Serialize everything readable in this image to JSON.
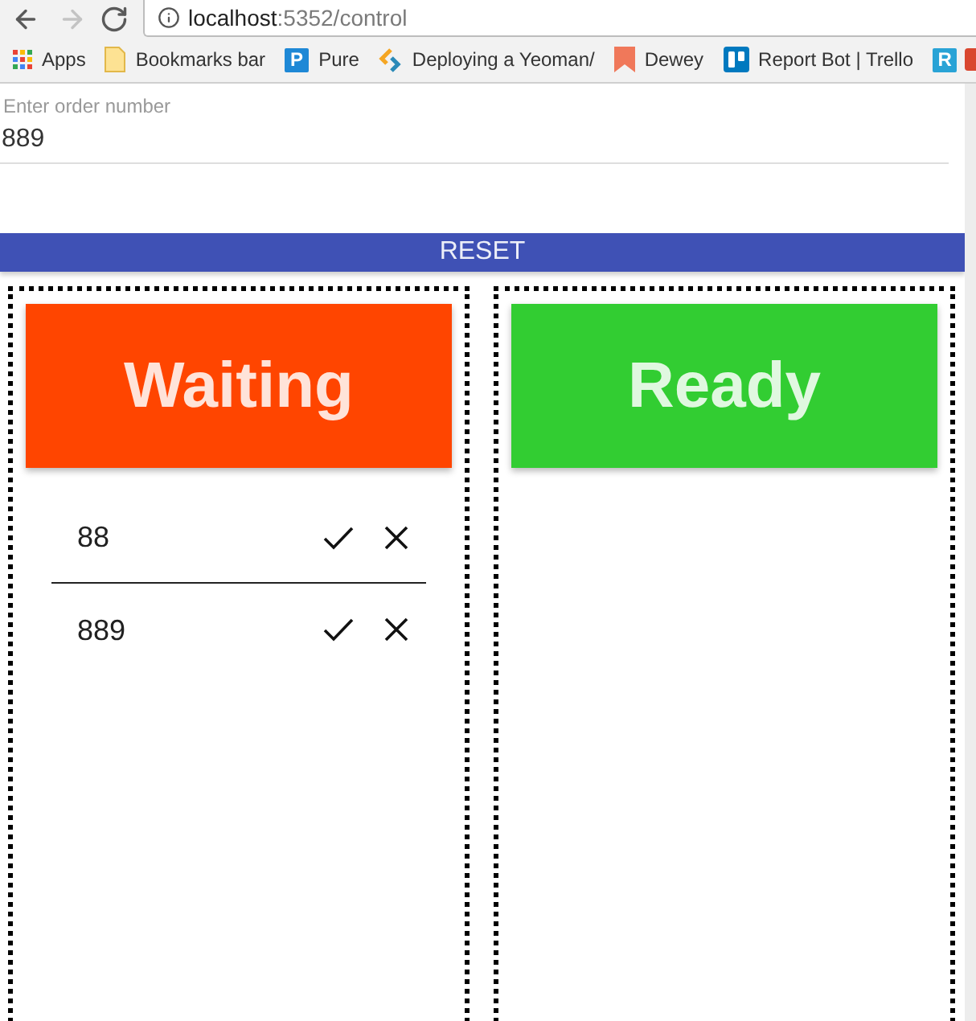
{
  "browser": {
    "nav_buttons": [
      {
        "kind": "back",
        "disabled": false
      },
      {
        "kind": "forward",
        "disabled": true
      },
      {
        "kind": "reload",
        "disabled": false
      }
    ],
    "url": {
      "host": "localhost",
      "path": ":5352/control"
    },
    "bookmarks": [
      {
        "kind": "apps",
        "label": "Apps"
      },
      {
        "kind": "folder",
        "label": "Bookmarks bar"
      },
      {
        "kind": "letter",
        "icon_text": "P",
        "color": "#1e88d6",
        "label": "Pure"
      },
      {
        "kind": "chevrons",
        "label": "Deploying a Yeoman/"
      },
      {
        "kind": "ribbon",
        "label": "Dewey"
      },
      {
        "kind": "board",
        "label": "Report Bot | Trello"
      },
      {
        "kind": "letter",
        "icon_text": "R",
        "color": "#29a3d6"
      },
      {
        "kind": "cut"
      }
    ]
  },
  "order_input": {
    "label": "Enter order number",
    "value": "889"
  },
  "reset_button": "RESET",
  "columns": [
    {
      "title": "Waiting",
      "color": "#ff4500",
      "orders": [
        {
          "number": "88"
        },
        {
          "number": "889"
        }
      ]
    },
    {
      "title": "Ready",
      "color": "#32cd32"
    }
  ]
}
